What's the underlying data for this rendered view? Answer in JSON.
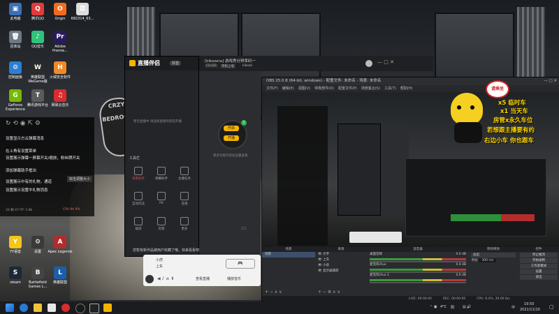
{
  "desktop_icons": [
    {
      "label": "此电脑",
      "color": "#3b6fb6",
      "glyph": "▣"
    },
    {
      "label": "腾讯QQ",
      "color": "#e23a3a",
      "glyph": "Q"
    },
    {
      "label": "Origin",
      "color": "#f26b1d",
      "glyph": "O"
    },
    {
      "label": "682314_63...",
      "color": "#ddd",
      "glyph": "◘"
    },
    {
      "label": "回收站",
      "color": "#6d7a86",
      "glyph": "🗑"
    },
    {
      "label": "QQ音乐",
      "color": "#31c27c",
      "glyph": "♪"
    },
    {
      "label": "Adobe Premie...",
      "color": "#2a1a5e",
      "glyph": "Pr"
    },
    {
      "label": "控制面板",
      "color": "#2d7dd2",
      "glyph": "⚙"
    },
    {
      "label": "英雄联盟WeGame版",
      "color": "#2b2b2b",
      "glyph": "W"
    },
    {
      "label": "火绒安全软件",
      "color": "#f08a24",
      "glyph": "H"
    },
    {
      "label": "GeForce Experience",
      "color": "#76b900",
      "glyph": "G"
    },
    {
      "label": "腾讯游戏平台",
      "color": "#5b5b5b",
      "glyph": "T"
    },
    {
      "label": "网易云音乐",
      "color": "#d72d2d",
      "glyph": "♫"
    },
    {
      "label": "YY语音",
      "color": "#f5c518",
      "glyph": "Y"
    },
    {
      "label": "设置",
      "color": "#3a3a3a",
      "glyph": "⚙"
    },
    {
      "label": "Apex Legends",
      "color": "#b12d2d",
      "glyph": "A"
    },
    {
      "label": "steam",
      "color": "#1b2838",
      "glyph": "S"
    },
    {
      "label": "Battlefield Games L...",
      "color": "#444",
      "glyph": "B"
    },
    {
      "label": "英雄联盟",
      "color": "#1c5fa8",
      "glyph": "L"
    }
  ],
  "chat": {
    "messages": [
      "设置显示方云弹幕消息",
      "在上角有设置菜单",
      "设置展示弹幕一屏幕开关/缩放，粉丝牌开关",
      "添加弹幕助手框出",
      "设置展示中有的礼物，通道",
      "设置展示设置中礼物消息"
    ],
    "hint": "双击调整大小",
    "footer_left": "33 帧 47 FP: 1.8k",
    "footer_right": "CPU 9k 9%"
  },
  "streamer_app": {
    "title": "直播伴侣",
    "badge": "抖音",
    "status": "暂无直播中 请选择直播场景后开播",
    "section": "工具栏",
    "tools": [
      "场景助手",
      "弹幕助手",
      "主播任务",
      "互动玩法",
      "PK",
      "连线",
      "福袋",
      "房管",
      "更多"
    ],
    "channel_tag": "kikozera",
    "channel_status": "[kikozera] 游戏秀分辨率码一",
    "chip_a": "CS:GO",
    "chip_b": "带粉上墙",
    "chip_c": "kikoze",
    "bottom_notice": "您暂有新作品被用户收藏了哦，快来看看吧"
  },
  "preview": {
    "start_label": "开启",
    "live_label": "开播",
    "count": "1",
    "hint": "更多功能可前往设置查看"
  },
  "chatbox": {
    "line1": "小虎",
    "line2": "上车",
    "action1": "查看直播",
    "action2": "播放音乐"
  },
  "obs": {
    "title": "OBS 25.0.8 (64-bit, windows) - 配置文件: 未命名 - 场景: 未命名",
    "menu": [
      "文件(F)",
      "编辑(E)",
      "视图(V)",
      "停靠部件(D)",
      "配置文件(P)",
      "场景集合(S)",
      "工具(T)",
      "帮助(H)"
    ],
    "docks": {
      "scenes": "场景",
      "sources": "来源",
      "mixer": "混音器",
      "transitions": "转场特效",
      "controls": "控件"
    },
    "scene_list": [
      "场景"
    ],
    "source_list": [
      "文字",
      "上车",
      "小虎",
      "显示器捕获"
    ],
    "mixer_channels": [
      {
        "name": "桌面音频",
        "db": "0.0 dB"
      },
      {
        "name": "麦克风/Aux",
        "db": "0.0 dB"
      },
      {
        "name": "麦克风/Aux 2",
        "db": "0.0 dB"
      }
    ],
    "transition": "淡出",
    "duration_label": "时长",
    "duration": "300 ms",
    "controls": [
      "停止推流",
      "开始录制",
      "工作室模式",
      "设置",
      "退出"
    ],
    "status": [
      "LIVE: 00:00:00",
      "REC: 00:00:00",
      "CPU: 8.4%, 30.00 fps"
    ]
  },
  "overlay": {
    "sign": "请乘坐",
    "lines": [
      "x5 临时车",
      "x1 当天车",
      "房管x永久车位",
      "若想跟主播要有约",
      "右边小车 你也跟车"
    ]
  },
  "taskbar": {
    "temp": "4°C",
    "weather": "阴",
    "ime": "中",
    "time": "19:50",
    "date": "2021/11/10"
  },
  "colors": {
    "accent": "#f5b400",
    "obs_bg": "#1e1f22",
    "taskbar": "#1b1c20"
  }
}
